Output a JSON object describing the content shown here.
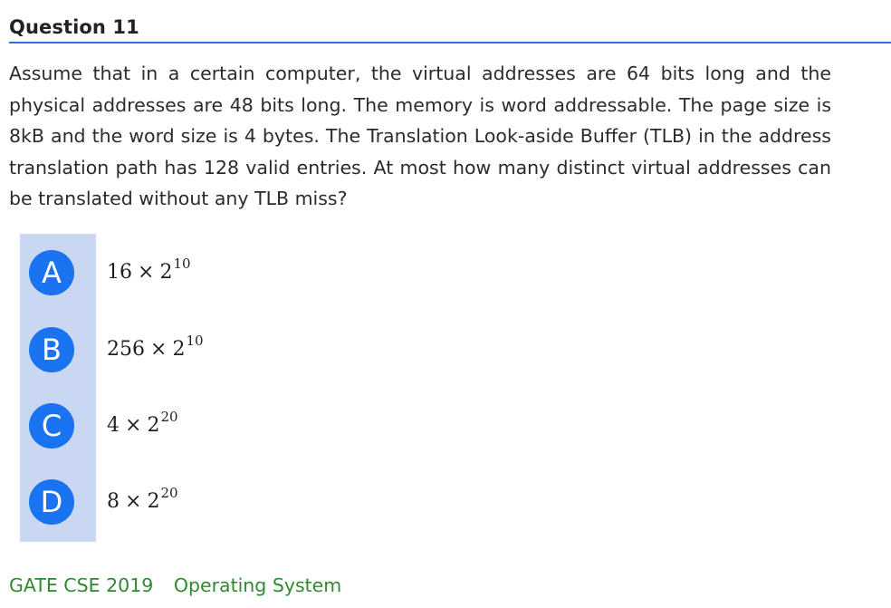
{
  "question": {
    "title": "Question 11",
    "text": "Assume that in a certain computer, the virtual addresses are 64 bits long and the physical addresses are 48 bits long. The memory is word addressable. The page size is 8kB and the word size is 4 bytes. The Translation Look-aside Buffer (TLB) in the address translation path has 128 valid entries. At most how many distinct virtual addresses can be translated without any TLB miss?"
  },
  "options": [
    {
      "letter": "A",
      "coef": "16",
      "times": "×",
      "base": "2",
      "exp": "10"
    },
    {
      "letter": "B",
      "coef": "256",
      "times": "×",
      "base": "2",
      "exp": "10"
    },
    {
      "letter": "C",
      "coef": "4",
      "times": "×",
      "base": "2",
      "exp": "20"
    },
    {
      "letter": "D",
      "coef": "8",
      "times": "×",
      "base": "2",
      "exp": "20"
    }
  ],
  "tags": [
    "GATE CSE 2019",
    "Operating System"
  ],
  "colors": {
    "accent": "#1a73f0",
    "options_bar": "#c9d7f3",
    "header_rule": "#2f6fd6",
    "tag_text": "#2f8a2f"
  }
}
